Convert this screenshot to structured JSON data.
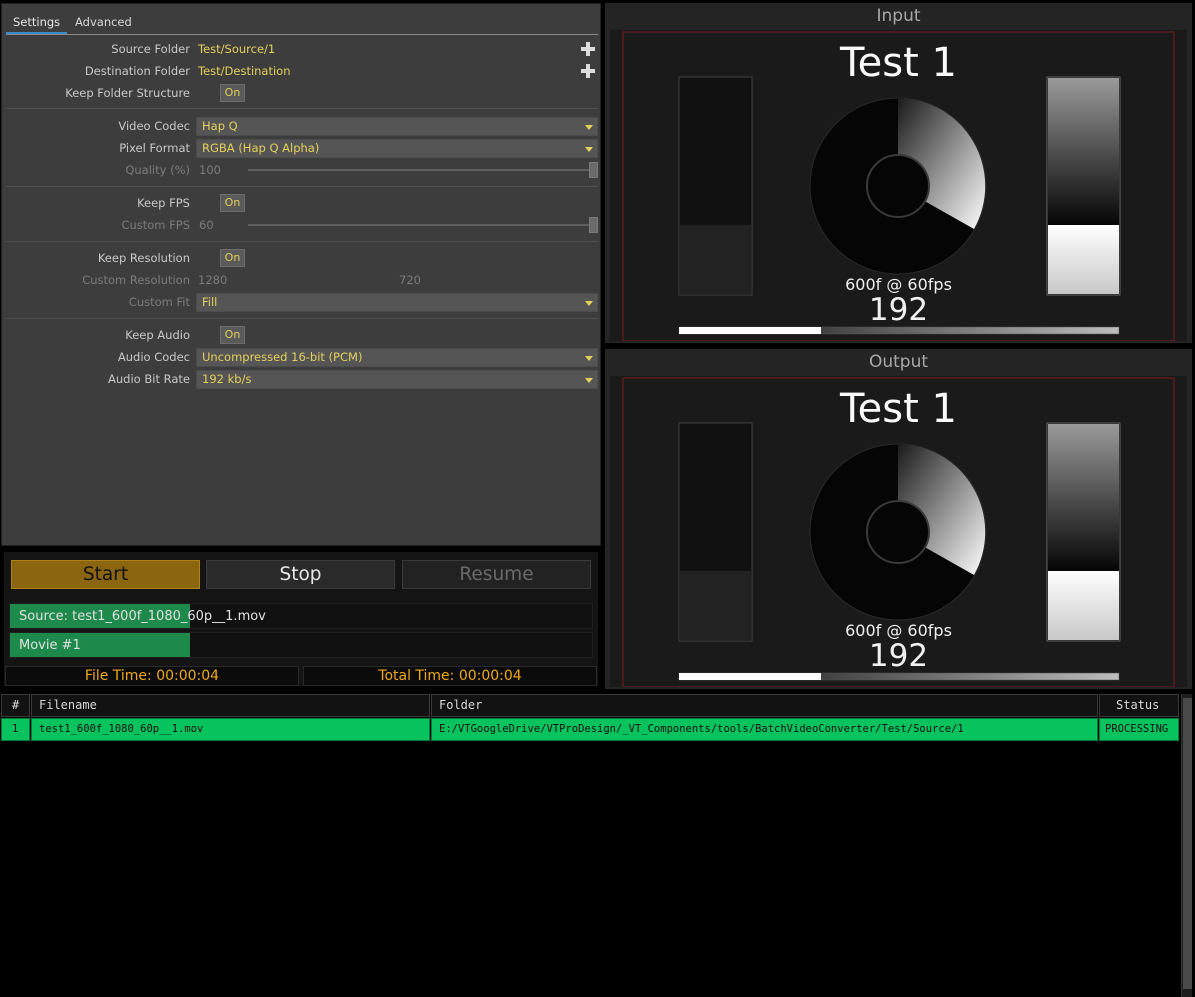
{
  "settings": {
    "tabs": [
      "Settings",
      "Advanced"
    ],
    "source_folder": {
      "label": "Source Folder",
      "value": "Test/Source/1"
    },
    "destination_folder": {
      "label": "Destination Folder",
      "value": "Test/Destination"
    },
    "keep_folder_structure": {
      "label": "Keep Folder Structure",
      "value": "On"
    },
    "video_codec": {
      "label": "Video Codec",
      "value": "Hap Q"
    },
    "pixel_format": {
      "label": "Pixel Format",
      "value": "RGBA (Hap Q Alpha)"
    },
    "quality": {
      "label": "Quality (%)",
      "value": "100"
    },
    "keep_fps": {
      "label": "Keep FPS",
      "value": "On"
    },
    "custom_fps": {
      "label": "Custom FPS",
      "value": "60"
    },
    "keep_resolution": {
      "label": "Keep Resolution",
      "value": "On"
    },
    "custom_resolution": {
      "label": "Custom Resolution",
      "width": "1280",
      "height": "720"
    },
    "custom_fit": {
      "label": "Custom Fit",
      "value": "Fill"
    },
    "keep_audio": {
      "label": "Keep Audio",
      "value": "On"
    },
    "audio_codec": {
      "label": "Audio Codec",
      "value": "Uncompressed 16-bit (PCM)"
    },
    "audio_bit_rate": {
      "label": "Audio Bit Rate",
      "value": "192 kb/s"
    }
  },
  "transport": {
    "start": "Start",
    "stop": "Stop",
    "resume": "Resume",
    "source_progress": {
      "text": "Source: test1_600f_1080_60p__1.mov",
      "fraction": 0.31
    },
    "movie_progress": {
      "text": "Movie #1",
      "fraction": 0.31
    },
    "file_time": "File Time: 00:00:04",
    "total_time": "Total Time: 00:00:04"
  },
  "monitors": {
    "input": {
      "title": "Input",
      "frame_title": "Test 1",
      "fps_label": "600f @ 60fps",
      "frame_number": "192"
    },
    "output": {
      "title": "Output",
      "frame_title": "Test 1",
      "fps_label": "600f @ 60fps",
      "frame_number": "192"
    }
  },
  "table": {
    "headers": {
      "num": "#",
      "filename": "Filename",
      "folder": "Folder",
      "status": "Status"
    },
    "rows": [
      {
        "num": "1",
        "filename": "test1_600f_1080_60p__1.mov",
        "folder": "E:/VTGoogleDrive/VTProDesign/_VT_Components/tools/BatchVideoConverter/Test/Source/1",
        "status": "PROCESSING"
      }
    ]
  },
  "colors": {
    "accent": "#e5d15a",
    "progress": "#1d8a4c",
    "row_processing": "#06c35e",
    "time": "#f0a818",
    "start_button": "#8b6510"
  }
}
